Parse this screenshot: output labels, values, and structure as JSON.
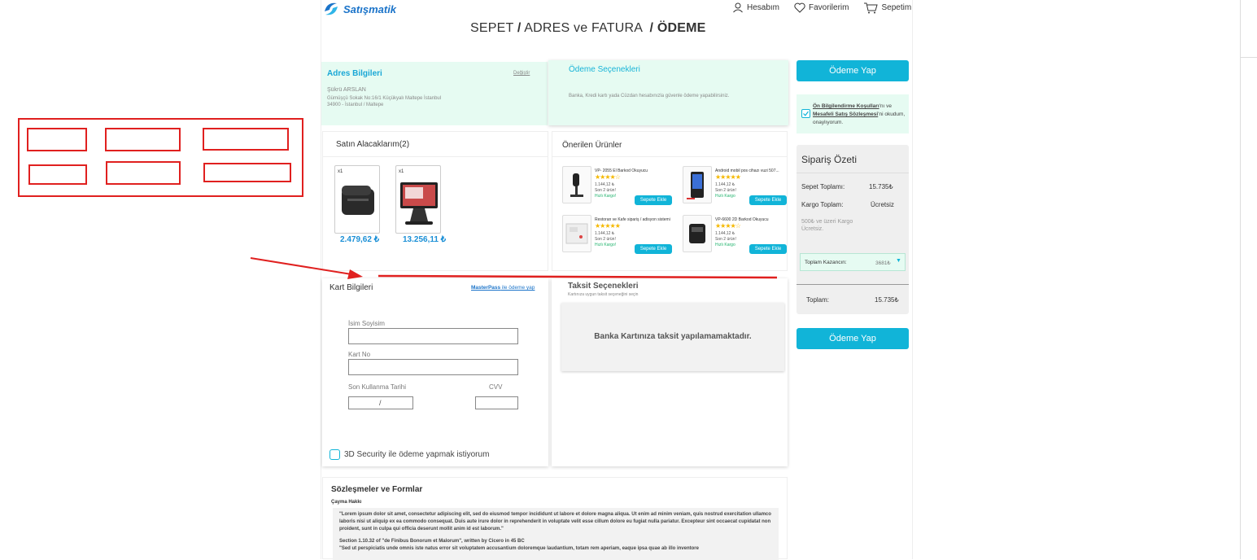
{
  "brand": {
    "name": "Satışmatik",
    "color": "#1a73c9"
  },
  "nav": {
    "account": "Hesabım",
    "favorites": "Favorilerim",
    "cart": "Sepetim"
  },
  "steps": {
    "cart": "SEPET",
    "sep1": "/",
    "address": "ADRES ve FATURA",
    "sep2": "/",
    "payment": "ÖDEME"
  },
  "address": {
    "title": "Adres Bilgileri",
    "change": "Değiştir",
    "name": "Şükrü ARSLAN",
    "line1": "Gümüşçü Sokak No:16/1 Küçükyalı Maltepe İstanbul",
    "line2": "34900 - İstanbul / Maltepe"
  },
  "payment_options": {
    "title": "Ödeme Seçenekleri",
    "desc": "Banka, Kredi kartı yada Cüzdan hesabınızla güvenle ödeme yapabilirsiniz."
  },
  "pay_button_top": "Ödeme Yap",
  "pay_button_bottom": "Ödeme  Yap",
  "agreement": {
    "link1": "Ön Bilgilendirme Koşulları",
    "mid": "'nı ve",
    "link2": "Mesafeli Satış Sözleşmesi",
    "end": "'ni okudum, onaylıyorum."
  },
  "purchases": {
    "title": "Satın Alacaklarım(2)",
    "items": [
      {
        "qty": "x1",
        "price": "2.479,62 ₺",
        "icon": "receipt-printer"
      },
      {
        "qty": "x1",
        "price": "13.256,11 ₺",
        "icon": "pos-terminal"
      }
    ]
  },
  "recommended": {
    "title": "Önerilen Ürünler",
    "items": [
      {
        "name": "VP- 2055 El Barkod Okuyucu",
        "stars": "★★★★☆",
        "price": "1.144,12 ₺",
        "stock": "Son 2 ürün!",
        "cargo": "Hızlı Kargo!",
        "button": "Sepete Ekle"
      },
      {
        "name": "Android mobil pos cihazı vuzi 507...",
        "stars": "★★★★★",
        "price": "1.144,12 ₺",
        "stock": "Son 2 ürün!",
        "cargo": "Hızlı Kargo",
        "button": "Sepete Ekle"
      },
      {
        "name": "Restoran ve Kafe sipariş / adisyon sistemi",
        "stars": "★★★★★",
        "price": "1.144,12 ₺",
        "stock": "Son 2 ürün!",
        "cargo": "Hızlı Kargo!",
        "button": "Sepete Ekle"
      },
      {
        "name": "VP-6600 2D Barkod Okuyucu",
        "stars": "★★★★☆",
        "price": "1.144,12 ₺",
        "stock": "Son 2 ürün!",
        "cargo": "Hızlı Kargo",
        "button": "Sepete Ekle"
      }
    ]
  },
  "card": {
    "title": "Kart Bilgileri",
    "masterpass_link": "MasterPass",
    "masterpass_text": " ile ödeme yap",
    "name_label": "İsim Soyisim",
    "number_label": "Kart No",
    "expiry_label": "Son Kullanma Tarihi",
    "cvv_label": "CVV",
    "expiry_sep": "/",
    "secure_label": "3D Security ile ödeme yapmak istiyorum"
  },
  "installments": {
    "title": "Taksit Seçenekleri",
    "subtitle": "Kartınıza uygun taksit seçeneğini seçin",
    "message": "Banka Kartınıza taksit yapılamamaktadır."
  },
  "summary": {
    "title": "Sipariş Özeti",
    "cart_total_label": "Sepet Toplamı:",
    "cart_total": "15.735₺",
    "cargo_label": "Kargo Toplam:",
    "cargo": "Ücretsiz",
    "note": "500₺ ve üzeri Kargo Ücretsiz.",
    "savings_label": "Toplam Kazancın:",
    "savings": "3681₺",
    "total_label": "Toplam:",
    "total": "15.735₺"
  },
  "contracts": {
    "title": "Sözleşmeler ve Formlar",
    "subtitle": "Çayma Hakkı",
    "para1": "\"Lorem ipsum dolor sit amet, consectetur adipiscing elit, sed do eiusmod tempor incididunt ut labore et dolore magna aliqua. Ut enim ad minim veniam, quis nostrud exercitation ullamco laboris nisi ut aliquip ex ea commodo consequat. Duis aute irure dolor in reprehenderit in voluptate velit esse cillum dolore eu fugiat nulla pariatur. Excepteur sint occaecat cupidatat non proident, sunt in culpa qui officia deserunt mollit anim id est laborum.\"",
    "heading2": "Section 1.10.32 of \"de Finibus Bonorum et Malorum\", written by Cicero in 45 BC",
    "para2": "\"Sed ut perspiciatis unde omnis iste natus error sit voluptatem accusantium doloremque laudantium, totam rem aperiam, eaque ipsa quae ab illo inventore"
  },
  "colors": {
    "accent": "#11b4d8",
    "mint": "#e6fbf2",
    "annotation": "#e0201f",
    "price": "#1a8fd6",
    "star": "#f5b800"
  }
}
